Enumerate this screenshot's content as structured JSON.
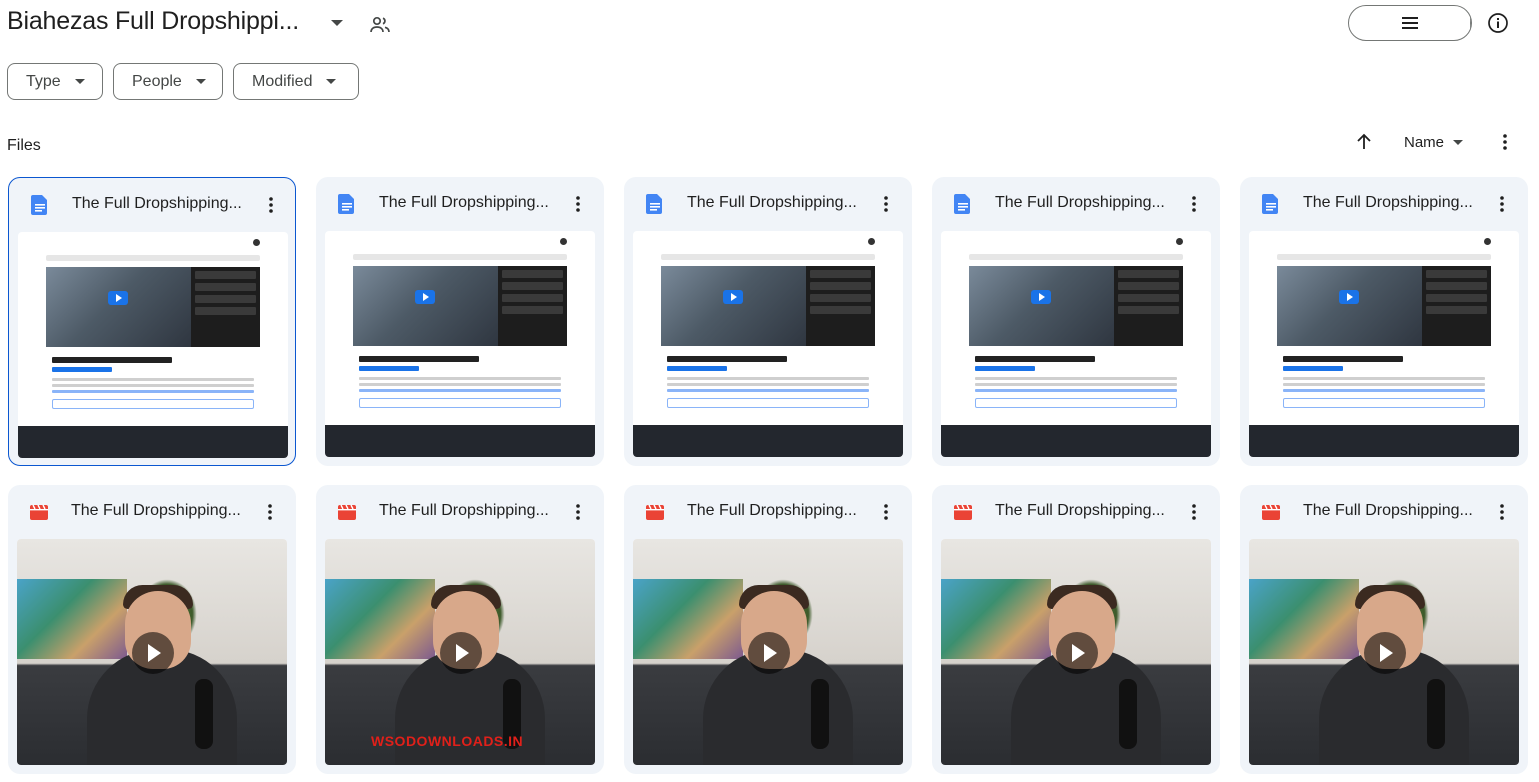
{
  "header": {
    "folder_title": "Biahezas Full Dropshippi...",
    "shared_icon": "people-icon",
    "view_toggle": {
      "list_icon": "list-icon",
      "grid_icon": "grid-icon",
      "active": "grid"
    },
    "info_icon": "info-icon"
  },
  "filters": [
    {
      "label": "Type"
    },
    {
      "label": "People"
    },
    {
      "label": "Modified"
    }
  ],
  "files_section": {
    "label": "Files",
    "sort_direction_icon": "arrow-up-icon",
    "sort_label": "Name"
  },
  "cards": [
    {
      "title": "The Full Dropshipping...",
      "kind": "doc",
      "selected": true
    },
    {
      "title": "The Full Dropshipping...",
      "kind": "doc"
    },
    {
      "title": "The Full Dropshipping...",
      "kind": "doc"
    },
    {
      "title": "The Full Dropshipping...",
      "kind": "doc"
    },
    {
      "title": "The Full Dropshipping...",
      "kind": "doc"
    },
    {
      "title": "The Full Dropshipping...",
      "kind": "video"
    },
    {
      "title": "The Full Dropshipping...",
      "kind": "video",
      "watermark": "WSODOWNLOADS.IN"
    },
    {
      "title": "The Full Dropshipping...",
      "kind": "video"
    },
    {
      "title": "The Full Dropshipping...",
      "kind": "video"
    },
    {
      "title": "The Full Dropshipping...",
      "kind": "video"
    }
  ],
  "colors": {
    "accent": "#0b57d0",
    "doc_icon": "#4285f4",
    "video_icon": "#ea4335",
    "card_bg": "#f0f4f9",
    "toggle_active": "#c2e7ff"
  }
}
